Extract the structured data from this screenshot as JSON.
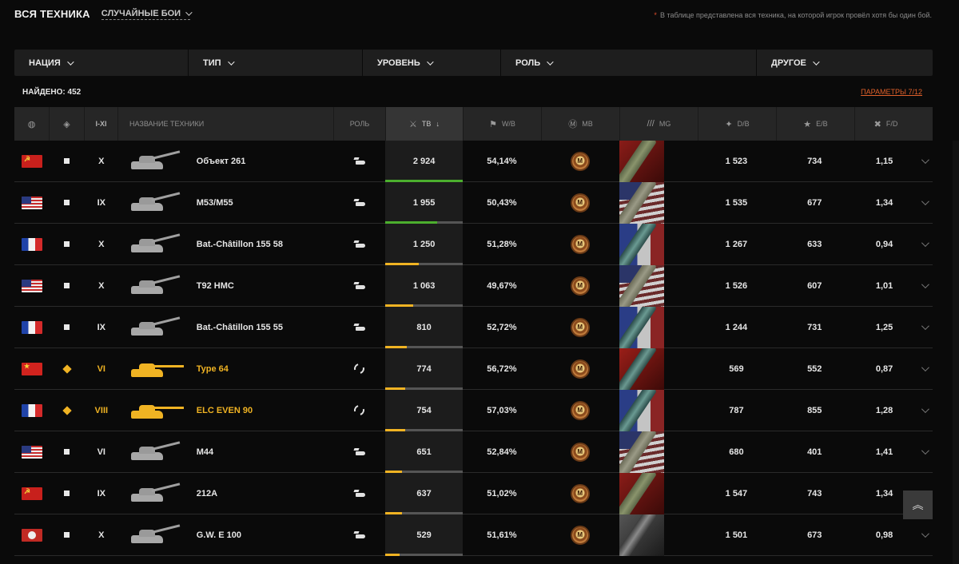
{
  "header": {
    "title": "ВСЯ ТЕХНИКА",
    "mode": "СЛУЧАЙНЫЕ БОИ",
    "note": "В таблице представлена вся техника, на которой игрок провёл хотя бы один бой."
  },
  "filters": [
    {
      "label": "НАЦИЯ"
    },
    {
      "label": "ТИП"
    },
    {
      "label": "УРОВЕНЬ"
    },
    {
      "label": "РОЛЬ"
    },
    {
      "label": "ДРУГОЕ"
    }
  ],
  "summary": {
    "found": "НАЙДЕНО: 452",
    "params": "ПАРАМЕТРЫ 7/12"
  },
  "columns": {
    "nation_icon": "globe-icon",
    "type_icon": "vehicle-type-icon",
    "tier": "I-XI",
    "name": "НАЗВАНИЕ ТЕХНИКИ",
    "role": "РОЛЬ",
    "battles": "ТВ",
    "battles_sort": "↓",
    "winrate": "W/B",
    "mastery": "MB",
    "marks": "MG",
    "damage": "D/B",
    "exp": "E/B",
    "frags": "F/D"
  },
  "colors": {
    "premium": "#f0b323",
    "accent_link": "#e0602a",
    "bar_green": "#4caf2e",
    "bar_yellow": "#f0b323",
    "bar_track": "#555555"
  },
  "rows": [
    {
      "nation": "ussr",
      "type": "spg",
      "premium": false,
      "tier": "X",
      "name": "Объект 261",
      "role": "spg",
      "battles": "2 924",
      "battles_fill": 1.0,
      "bar_color": "green",
      "winrate": "54,14%",
      "mark_nation": "ussr",
      "damage": "1 523",
      "exp": "734",
      "frags": "1,15"
    },
    {
      "nation": "usa",
      "type": "spg",
      "premium": false,
      "tier": "IX",
      "name": "M53/M55",
      "role": "spg",
      "battles": "1 955",
      "battles_fill": 0.67,
      "bar_color": "green",
      "winrate": "50,43%",
      "mark_nation": "usa",
      "damage": "1 535",
      "exp": "677",
      "frags": "1,34"
    },
    {
      "nation": "france",
      "type": "spg",
      "premium": false,
      "tier": "X",
      "name": "Bat.-Châtillon 155 58",
      "role": "spg",
      "battles": "1 250",
      "battles_fill": 0.43,
      "bar_color": "yellow",
      "winrate": "51,28%",
      "mark_nation": "fr",
      "damage": "1 267",
      "exp": "633",
      "frags": "0,94"
    },
    {
      "nation": "usa",
      "type": "spg",
      "premium": false,
      "tier": "X",
      "name": "T92 HMC",
      "role": "spg",
      "battles": "1 063",
      "battles_fill": 0.36,
      "bar_color": "yellow",
      "winrate": "49,67%",
      "mark_nation": "usa",
      "damage": "1 526",
      "exp": "607",
      "frags": "1,01"
    },
    {
      "nation": "france",
      "type": "spg",
      "premium": false,
      "tier": "IX",
      "name": "Bat.-Châtillon 155 55",
      "role": "spg",
      "battles": "810",
      "battles_fill": 0.28,
      "bar_color": "yellow",
      "winrate": "52,72%",
      "mark_nation": "fr",
      "damage": "1 244",
      "exp": "731",
      "frags": "1,25"
    },
    {
      "nation": "china",
      "type": "light",
      "premium": true,
      "tier": "VI",
      "name": "Type 64",
      "role": "support",
      "battles": "774",
      "battles_fill": 0.26,
      "bar_color": "yellow",
      "winrate": "56,72%",
      "mark_nation": "cn",
      "damage": "569",
      "exp": "552",
      "frags": "0,87"
    },
    {
      "nation": "france",
      "type": "light",
      "premium": true,
      "tier": "VIII",
      "name": "ELC EVEN 90",
      "role": "support",
      "battles": "754",
      "battles_fill": 0.26,
      "bar_color": "yellow",
      "winrate": "57,03%",
      "mark_nation": "fr",
      "damage": "787",
      "exp": "855",
      "frags": "1,28"
    },
    {
      "nation": "usa",
      "type": "spg",
      "premium": false,
      "tier": "VI",
      "name": "M44",
      "role": "spg",
      "battles": "651",
      "battles_fill": 0.22,
      "bar_color": "yellow",
      "winrate": "52,84%",
      "mark_nation": "usa",
      "damage": "680",
      "exp": "401",
      "frags": "1,41"
    },
    {
      "nation": "ussr",
      "type": "spg",
      "premium": false,
      "tier": "IX",
      "name": "212A",
      "role": "spg",
      "battles": "637",
      "battles_fill": 0.22,
      "bar_color": "yellow",
      "winrate": "51,02%",
      "mark_nation": "ussr",
      "damage": "1 547",
      "exp": "743",
      "frags": "1,34"
    },
    {
      "nation": "germany",
      "type": "spg",
      "premium": false,
      "tier": "X",
      "name": "G.W. E 100",
      "role": "spg",
      "battles": "529",
      "battles_fill": 0.18,
      "bar_color": "yellow",
      "winrate": "51,61%",
      "mark_nation": "de",
      "damage": "1 501",
      "exp": "673",
      "frags": "0,98"
    }
  ],
  "scroll_top_icon": "double-chevron-up-icon"
}
